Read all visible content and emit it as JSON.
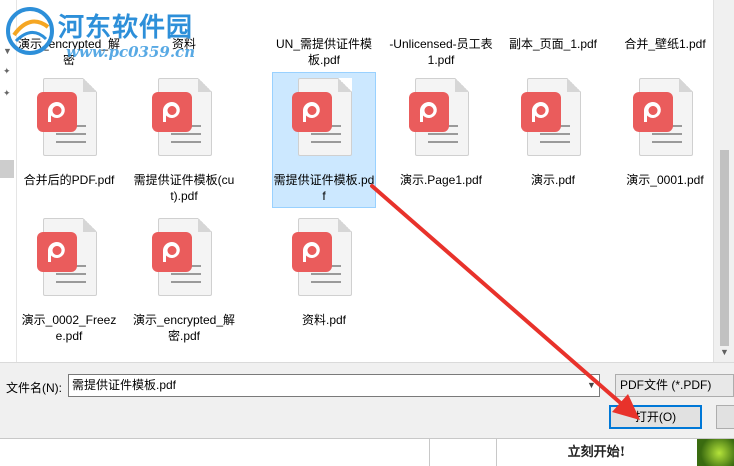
{
  "watermark": {
    "title": "河东软件园",
    "url": "www.pc0359.cn"
  },
  "files_top_row_partial": [
    {
      "label": "演示_encrypted_解密"
    },
    {
      "label": "资料"
    },
    {
      "label": "UN_需提供证件模板.pdf"
    },
    {
      "label": "-Unlicensed-员工表1.pdf"
    },
    {
      "label": "副本_页面_1.pdf"
    },
    {
      "label": "合并_壁纸1.pdf"
    }
  ],
  "files": [
    {
      "label": "合并后的PDF.pdf",
      "selected": false
    },
    {
      "label": "需提供证件模板(cut).pdf",
      "selected": false
    },
    {
      "label": "需提供证件模板.pdf",
      "selected": true
    },
    {
      "label": "演示.Page1.pdf",
      "selected": false
    },
    {
      "label": "演示.pdf",
      "selected": false
    },
    {
      "label": "演示_0001.pdf",
      "selected": false
    },
    {
      "label": "演示_0002_Freeze.pdf",
      "selected": false
    },
    {
      "label": "演示_encrypted_解密.pdf",
      "selected": false
    },
    {
      "label": "资料.pdf",
      "selected": false
    }
  ],
  "footer": {
    "filename_label": "文件名(N):",
    "filename_value": "需提供证件模板.pdf",
    "filetype_value": "PDF文件 (*.PDF)",
    "open_button": "打开(O)"
  },
  "underbar": {
    "start_label": "立刻开始!"
  },
  "colors": {
    "pdf_badge": "#ea5c5c",
    "selection_bg": "#cce8ff",
    "focus_border": "#0078d7",
    "annotation_arrow": "#e8322b"
  }
}
